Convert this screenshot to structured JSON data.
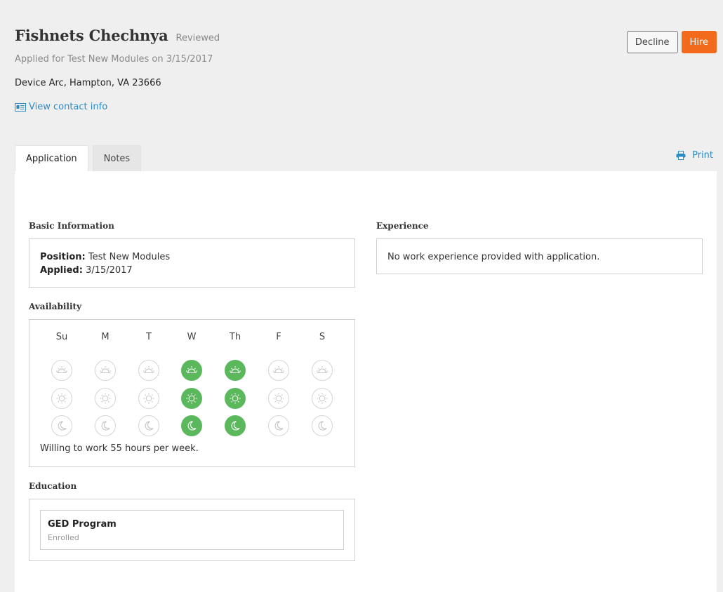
{
  "applicant": {
    "name": "Fishnets Chechnya",
    "status": "Reviewed",
    "applied_line": "Applied for Test New Modules on 3/15/2017",
    "address": "Device Arc, Hampton, VA 23666",
    "contact_link": "View contact info"
  },
  "actions": {
    "decline_label": "Decline",
    "hire_label": "Hire"
  },
  "tabs": [
    {
      "label": "Application",
      "active": true
    },
    {
      "label": "Notes",
      "active": false
    }
  ],
  "print_label": "Print",
  "basic_info": {
    "title": "Basic Information",
    "position_label": "Position:",
    "position_value": "Test New Modules",
    "applied_label": "Applied:",
    "applied_value": "3/15/2017"
  },
  "experience": {
    "title": "Experience",
    "empty_text": "No work experience provided with application."
  },
  "availability": {
    "title": "Availability",
    "days": [
      {
        "label": "Su",
        "morning": false,
        "day": false,
        "night": false
      },
      {
        "label": "M",
        "morning": false,
        "day": false,
        "night": false
      },
      {
        "label": "T",
        "morning": false,
        "day": false,
        "night": false
      },
      {
        "label": "W",
        "morning": true,
        "day": true,
        "night": true
      },
      {
        "label": "Th",
        "morning": true,
        "day": true,
        "night": true
      },
      {
        "label": "F",
        "morning": false,
        "day": false,
        "night": false
      },
      {
        "label": "S",
        "morning": false,
        "day": false,
        "night": false
      }
    ],
    "hours_text": "Willing to work 55 hours per week."
  },
  "education": {
    "title": "Education",
    "items": [
      {
        "name": "GED Program",
        "status": "Enrolled"
      }
    ]
  },
  "colors": {
    "accent": "#f26b1d",
    "link": "#2b8cc4",
    "available": "#5cb85c"
  }
}
